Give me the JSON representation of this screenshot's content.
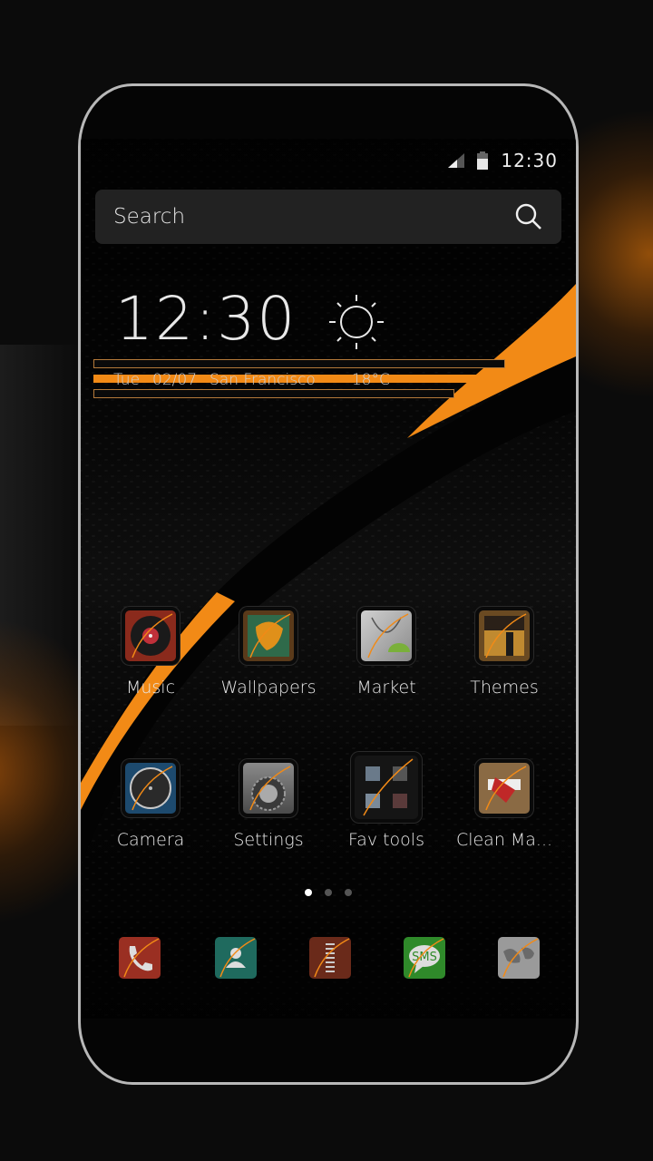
{
  "status_bar": {
    "time": "12:30",
    "icons": [
      "signal-icon",
      "battery-icon"
    ]
  },
  "search": {
    "placeholder": "Search",
    "icon": "search-icon"
  },
  "clock_widget": {
    "time": "12:30",
    "weather_icon": "sun-icon",
    "day": "Tue",
    "date": "02/07",
    "city": "San Francisco",
    "temperature": "18°C"
  },
  "apps": [
    {
      "label": "Music",
      "icon": "music-icon",
      "color": "#8a2a1c"
    },
    {
      "label": "Wallpapers",
      "icon": "wallpapers-icon",
      "color": "#5a3a1a"
    },
    {
      "label": "Market",
      "icon": "market-icon",
      "color": "#b8b8b8"
    },
    {
      "label": "Themes",
      "icon": "themes-icon",
      "color": "#6a4a22"
    },
    {
      "label": "Camera",
      "icon": "camera-icon",
      "color": "#1d4a6e"
    },
    {
      "label": "Settings",
      "icon": "settings-icon",
      "color": "#6a6a6a"
    },
    {
      "label": "Fav tools",
      "icon": "folder-icon",
      "color": "#151515"
    },
    {
      "label": "Clean Ma...",
      "icon": "clean-master-icon",
      "color": "#8a6a44"
    }
  ],
  "page_indicator": {
    "pages": 3,
    "active": 1
  },
  "dock": [
    {
      "name": "phone",
      "icon": "phone-icon",
      "color": "#9a2f22"
    },
    {
      "name": "contacts",
      "icon": "contacts-icon",
      "color": "#1f6a5e"
    },
    {
      "name": "apps-drawer",
      "icon": "app-drawer-icon",
      "color": "#6a2a1a"
    },
    {
      "name": "sms",
      "icon": "sms-icon",
      "color": "#2f8a2a",
      "text": "SMS"
    },
    {
      "name": "maps",
      "icon": "map-icon",
      "color": "#9a9a9a"
    }
  ],
  "colors": {
    "accent": "#f28a16",
    "frame": "#b8b8b8"
  }
}
